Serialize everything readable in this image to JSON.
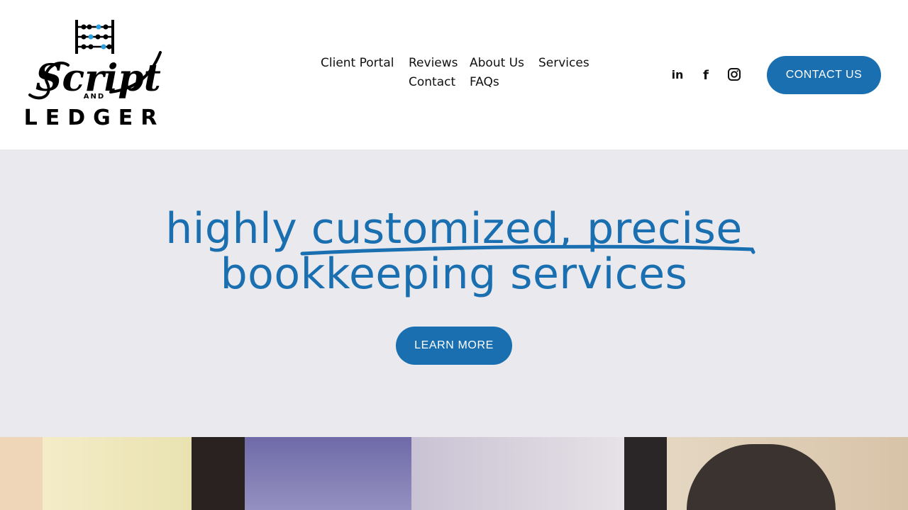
{
  "logo": {
    "script_text": "Script",
    "and_text": "AND",
    "ledger_text": "LEDGER"
  },
  "nav": {
    "items": [
      {
        "label": "Client Portal"
      },
      {
        "label": "Reviews"
      },
      {
        "label": "About Us"
      },
      {
        "label": "Services"
      },
      {
        "label": "Contact"
      },
      {
        "label": "FAQs"
      }
    ]
  },
  "social": {
    "linkedin": "in",
    "facebook": "f",
    "icons": [
      "linkedin-icon",
      "facebook-icon",
      "instagram-icon"
    ]
  },
  "header": {
    "cta_label": "CONTACT US"
  },
  "hero": {
    "line1_prefix": "highly ",
    "line1_emphasis": "customized, precise",
    "line2": "bookkeeping services",
    "button_label": "LEARN MORE"
  },
  "colors": {
    "brand_blue": "#1a6fb0",
    "hero_bg": "#e9e9ee",
    "abacus_bead_blue": "#2aa0e0"
  }
}
